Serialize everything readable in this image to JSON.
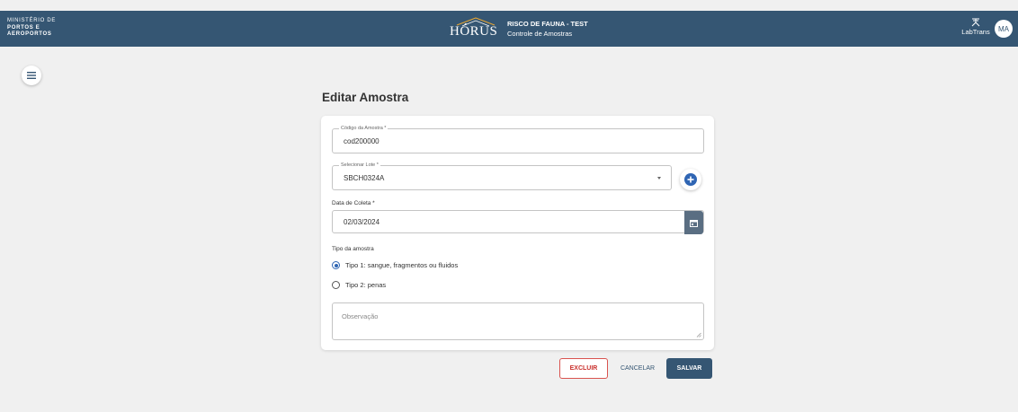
{
  "header": {
    "ministry_lines": [
      "MINISTÉRIO DE",
      "PORTOS E",
      "AEROPORTOS"
    ],
    "logo_text": "HÓRUS",
    "app_title": "RISCO DE FAUNA - TEST",
    "app_subtitle": "Controle de Amostras",
    "partner": "LabTrans",
    "avatar_initials": "MA"
  },
  "page": {
    "title": "Editar Amostra"
  },
  "form": {
    "codigo": {
      "label": "Código da Amostra *",
      "value": "cod200000"
    },
    "lote": {
      "label": "Selecionar Lote *",
      "value": "SBCH0324A"
    },
    "data_coleta": {
      "label": "Data de Coleta *",
      "value": "02/03/2024"
    },
    "tipo": {
      "label": "Tipo da amostra",
      "options": [
        {
          "label": "Tipo 1: sangue, fragmentos ou fluidos",
          "selected": true
        },
        {
          "label": "Tipo 2: penas",
          "selected": false
        }
      ]
    },
    "observacao": {
      "placeholder": "Observação",
      "value": ""
    }
  },
  "actions": {
    "delete_label": "EXCLUIR",
    "cancel_label": "CANCELAR",
    "save_label": "SALVAR"
  },
  "icons": {
    "menu": "hamburger-icon",
    "add": "plus-circle-icon",
    "calendar": "calendar-icon",
    "dropdown": "caret-down-icon",
    "labtrans": "labtrans-logo-icon"
  },
  "colors": {
    "header_bg": "#355673",
    "accent_blue": "#2f65b3",
    "danger": "#d9534f",
    "page_bg": "#f0f0f0"
  }
}
